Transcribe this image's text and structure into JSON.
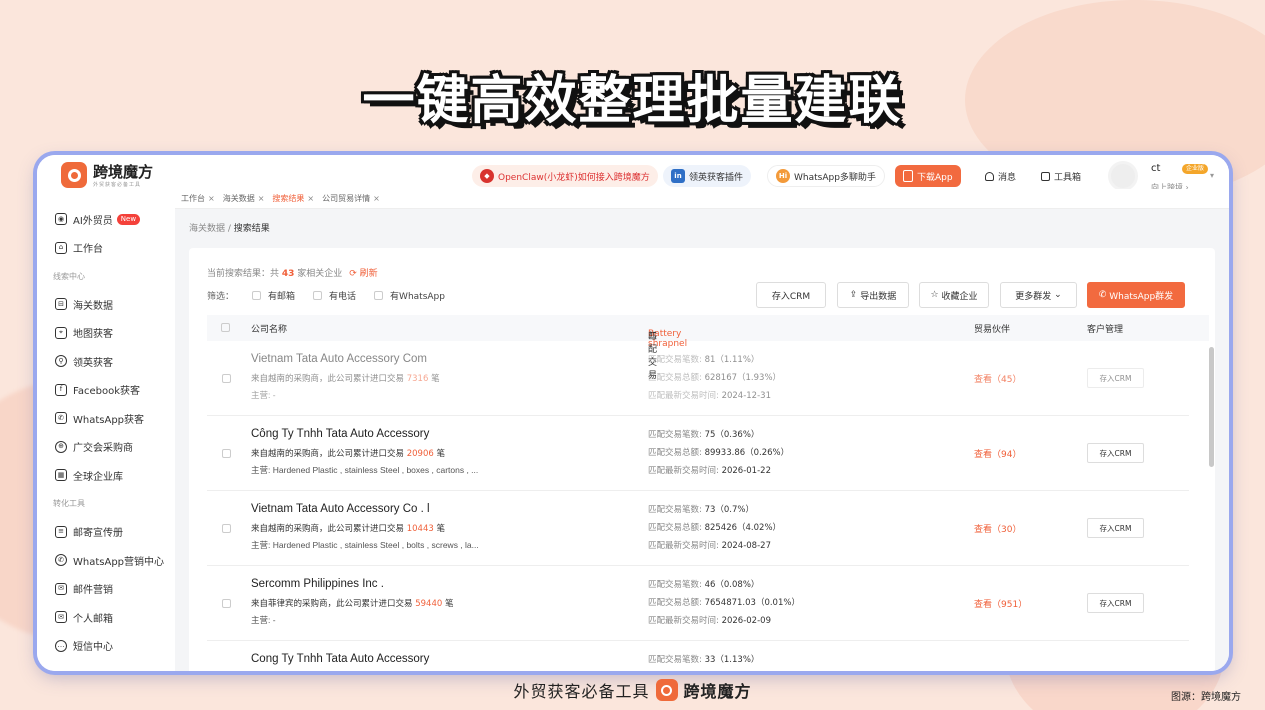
{
  "headline": "一键高效整理批量建联",
  "app": {
    "name": "跨境魔方",
    "slogan": "外贸获客必备工具"
  },
  "sidebar": {
    "top_items": [
      {
        "label": "AI外贸员",
        "badge": "New",
        "icon": "robot-icon"
      },
      {
        "label": "工作台",
        "icon": "home-icon"
      }
    ],
    "section1": "线索中心",
    "leads_items": [
      {
        "label": "海关数据",
        "icon": "customs-icon"
      },
      {
        "label": "地图获客",
        "icon": "map-icon"
      },
      {
        "label": "领英获客",
        "icon": "person-search-icon"
      },
      {
        "label": "Facebook获客",
        "icon": "facebook-icon"
      },
      {
        "label": "WhatsApp获客",
        "icon": "whatsapp-square-icon"
      },
      {
        "label": "广交会采购商",
        "icon": "globe-icon"
      },
      {
        "label": "全球企业库",
        "icon": "building-icon"
      }
    ],
    "section2": "转化工具",
    "tools_items": [
      {
        "label": "邮寄宣传册",
        "icon": "brochure-icon"
      },
      {
        "label": "WhatsApp营销中心",
        "icon": "whatsapp-icon"
      },
      {
        "label": "邮件营销",
        "icon": "mail-send-icon"
      },
      {
        "label": "个人邮箱",
        "icon": "mail-icon"
      },
      {
        "label": "短信中心",
        "icon": "sms-icon"
      }
    ]
  },
  "topbar": {
    "openclaw": "OpenClaw(小龙虾)如何接入跨境魔方",
    "linkedin_plugin": "领英获客插件",
    "whatsapp_helper": "WhatsApp多聊助手",
    "download": "下载App",
    "messages": "消息",
    "toolbox": "工具箱",
    "user_name": "ct",
    "user_badge": "企业版",
    "user_sub": "向上跨境 ›"
  },
  "tabs": [
    {
      "label": "工作台",
      "active": false
    },
    {
      "label": "海关数据",
      "active": false
    },
    {
      "label": "搜索结果",
      "active": true
    },
    {
      "label": "公司贸易详情",
      "active": false
    }
  ],
  "breadcrumb": {
    "parent": "海关数据",
    "current": "搜索结果"
  },
  "results": {
    "prefix": "当前搜索结果：共",
    "count": "43",
    "suffix": "家相关企业",
    "refresh": "刷新"
  },
  "filters": {
    "label": "筛选：",
    "options": [
      "有邮箱",
      "有电话",
      "有WhatsApp"
    ]
  },
  "actions": {
    "save_crm": "存入CRM",
    "export": "导出数据",
    "favorite": "收藏企业",
    "more_broadcast": "更多群发",
    "whatsapp_broadcast": "WhatsApp群发"
  },
  "table": {
    "headers": {
      "company": "公司名称",
      "match_prefix": "与",
      "keyword": "Battery shrapnel",
      "match_suffix": "匹配交易",
      "partners": "贸易伙伴",
      "customer_mgmt": "客户管理"
    },
    "labels": {
      "count": "匹配交易笔数:",
      "total": "匹配交易总额:",
      "latest": "匹配最新交易时间:",
      "main_prefix": "主营:",
      "view": "查看",
      "save": "存入CRM",
      "tx_unit": "笔"
    },
    "rows": [
      {
        "name": "Vietnam Tata Auto Accessory Com",
        "desc": "来自越南的采购商，此公司累计进口交易",
        "tx": "7316",
        "main": "-",
        "count": "81（1.11%）",
        "total": "628167（1.93%）",
        "latest": "2024-12-31",
        "partners": "（45）",
        "dim": true
      },
      {
        "name": "Công Ty Tnhh Tata Auto Accessory",
        "desc": "来自越南的采购商，此公司累计进口交易",
        "tx": "20906",
        "main": "Hardened Plastic , stainless Steel , boxes , cartons , ...",
        "count": "75（0.36%）",
        "total": "89933.86（0.26%）",
        "latest": "2026-01-22",
        "partners": "（94）",
        "dim": false
      },
      {
        "name": "Vietnam Tata Auto Accessory Co . l",
        "desc": "来自越南的采购商，此公司累计进口交易",
        "tx": "10443",
        "main": "Hardened Plastic , stainless Steel , bolts , screws , la...",
        "count": "73（0.7%）",
        "total": "825426（4.02%）",
        "latest": "2024-08-27",
        "partners": "（30）",
        "dim": false
      },
      {
        "name": "Sercomm Philippines Inc .",
        "desc": "来自菲律宾的采购商，此公司累计进口交易",
        "tx": "59440",
        "main": "-",
        "count": "46（0.08%）",
        "total": "7654871.03（0.01%）",
        "latest": "2026-02-09",
        "partners": "（951）",
        "dim": false
      },
      {
        "name": "Cong Ty Tnhh Tata Auto Accessory",
        "desc": "",
        "tx": "",
        "main": "",
        "count": "33（1.13%）",
        "total": "",
        "latest": "",
        "partners": "",
        "dim": false
      }
    ]
  },
  "cart_count": "0",
  "footer": {
    "text": "外贸获客必备工具",
    "brand": "跨境魔方",
    "source": "图源：跨境魔方"
  },
  "colors": {
    "accent": "#f26a3f",
    "window_border": "#9aa8ee"
  }
}
